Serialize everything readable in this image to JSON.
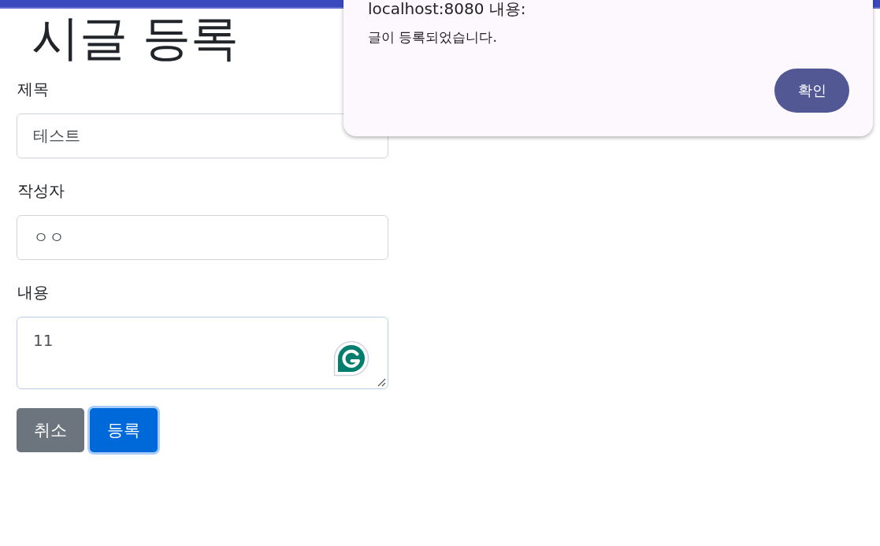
{
  "page": {
    "title": "시글 등록"
  },
  "form": {
    "fields": [
      {
        "kind": "input",
        "label": "제목",
        "value": "테스트"
      },
      {
        "kind": "input",
        "label": "작성자",
        "value": "ㅇㅇ"
      },
      {
        "kind": "textarea",
        "label": "내용",
        "value": "11"
      }
    ],
    "buttons": [
      {
        "kind": "secondary",
        "label": "취소",
        "focused": false
      },
      {
        "kind": "primary",
        "label": "등록",
        "focused": true
      }
    ]
  },
  "dialog": {
    "title": "localhost:8080 내용:",
    "message": "글이 등록되었습니다.",
    "button": "확인"
  }
}
